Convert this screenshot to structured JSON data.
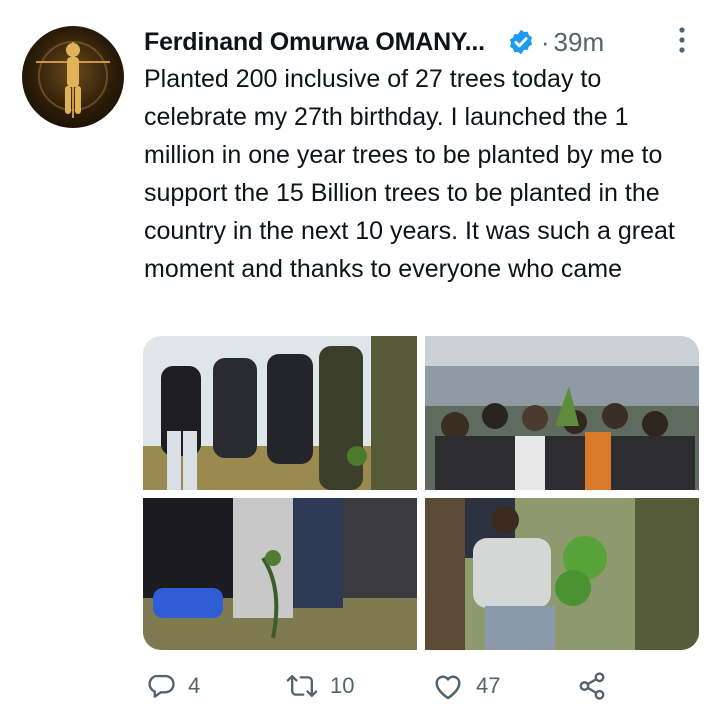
{
  "tweet": {
    "author_name": "Ferdinand Omurwa OMANY...",
    "separator": "·",
    "timestamp": "39m",
    "text": "Planted 200 inclusive of 27 trees today to celebrate my 27th birthday. I launched the 1 million in one year trees to be planted by me to support the 15 Billion trees to be planted in the country in the next 10 years. It was such a great moment and thanks to everyone who came"
  },
  "actions": {
    "reply_count": "4",
    "retweet_count": "10",
    "like_count": "47"
  },
  "icons": {
    "verified": "verified-badge-icon",
    "more": "more-vertical-icon",
    "reply": "reply-icon",
    "retweet": "retweet-icon",
    "like": "heart-icon",
    "share": "share-icon"
  },
  "colors": {
    "verified": "#1d9bf0",
    "text": "#0f1419",
    "secondary": "#536471"
  }
}
